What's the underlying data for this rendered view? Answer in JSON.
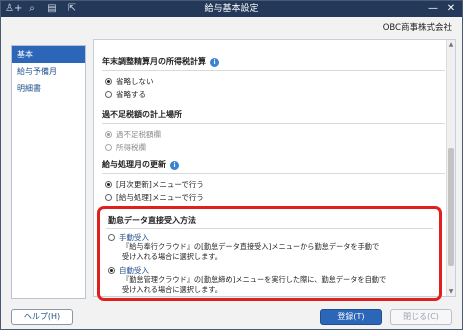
{
  "window": {
    "title": "給与基本設定"
  },
  "toolbar": {
    "icons": [
      "add-user-icon",
      "search-icon",
      "print-icon",
      "export-icon"
    ]
  },
  "company": {
    "name": "OBC商事株式会社"
  },
  "sidebar": {
    "items": [
      {
        "label": "基本"
      },
      {
        "label": "給与予備月"
      },
      {
        "label": "明細書"
      }
    ],
    "active": 0
  },
  "sections": {
    "year_end": {
      "title": "年末調整精算月の所得税計算",
      "options": [
        "省略しない",
        "省略する"
      ],
      "selected": 0
    },
    "shortage": {
      "title": "過不足税額の計上場所",
      "options": [
        "過不足税額欄",
        "所得税欄"
      ],
      "selected": 0
    },
    "update": {
      "title": "給与処理月の更新",
      "options": [
        "[月次更新]メニューで行う",
        "[給与処理]メニューで行う"
      ],
      "selected": 0
    },
    "attendance": {
      "title": "勤怠データ直接受入方法",
      "manual_label": "手動受入",
      "manual_desc1": "『給与奉行クラウド』の[勤怠データ直接受入]メニューから勤怠データを手動で",
      "manual_desc2": "受け入れる場合に選択します。",
      "auto_label": "自動受入",
      "auto_desc1": "『勤怠管理クラウド』の[勤怠締め]メニューを実行した際に、勤怠データを自動で",
      "auto_desc2": "受け入れる場合に選択します。",
      "selected": "auto"
    }
  },
  "footer": {
    "help": "ヘルプ(H)",
    "register": "登録(T)",
    "close": "閉じる(C)"
  }
}
